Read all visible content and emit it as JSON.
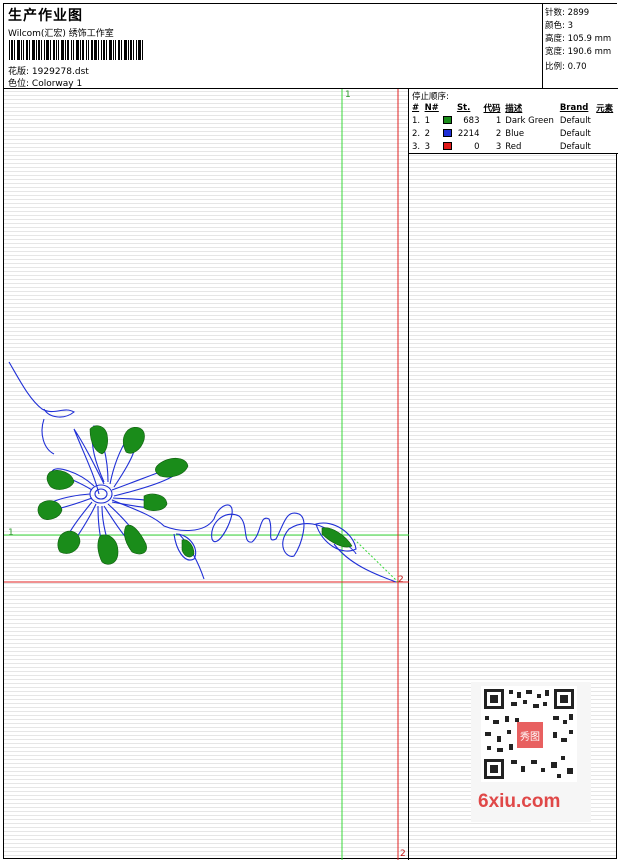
{
  "header": {
    "title": "生产作业图",
    "subtitle": "Wilcom(汇宏) 绣饰工作室",
    "design_file_label": "花版:",
    "design_file": "1929278.dst",
    "colorway_label": "色位:",
    "colorway": "Colorway 1"
  },
  "stats": [
    {
      "label": "针数:",
      "value": "2899"
    },
    {
      "label": "颜色:",
      "value": "3"
    },
    {
      "label": "高度:",
      "value": "105.9 mm"
    },
    {
      "label": "宽度:",
      "value": "190.6 mm"
    },
    {
      "label": "比例:",
      "value": "0.70"
    }
  ],
  "stop_sequence": {
    "title": "停止顺序:",
    "columns": [
      "#",
      "N#",
      "St.",
      "代码",
      "描述",
      "Brand",
      "元素"
    ],
    "rows": [
      {
        "idx": "1.",
        "n": "1",
        "color": "#1a8c1a",
        "stitches": "683",
        "code": "1",
        "desc": "Dark Green",
        "brand": "Default"
      },
      {
        "idx": "2.",
        "n": "2",
        "color": "#1f2fd6",
        "stitches": "2214",
        "code": "2",
        "desc": "Blue",
        "brand": "Default"
      },
      {
        "idx": "3.",
        "n": "3",
        "color": "#e01a1a",
        "stitches": "0",
        "code": "3",
        "desc": "Red",
        "brand": "Default"
      }
    ]
  },
  "guides": {
    "green_top": "1",
    "green_left": "1",
    "red_right": "2",
    "red_bottom": "2"
  },
  "colors": {
    "stitch_green": "#1a8c1a",
    "stitch_blue": "#1f2fd6",
    "guide_green": "#38d838",
    "guide_red": "#e02020"
  },
  "watermark": {
    "text": "6xiu.com",
    "badge": "秀图"
  }
}
